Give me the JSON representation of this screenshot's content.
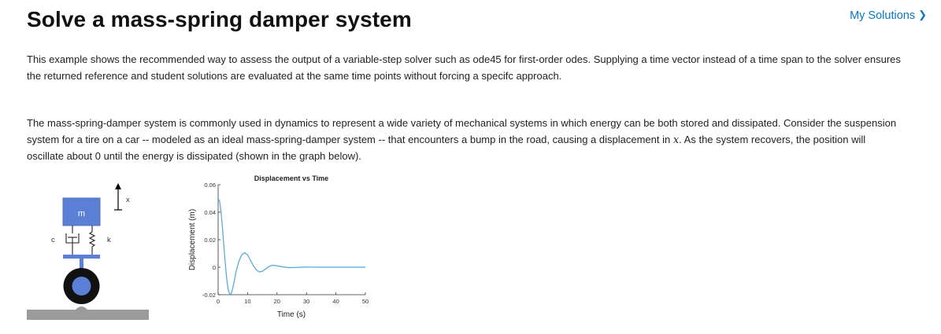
{
  "header": {
    "title": "Solve a mass-spring damper system",
    "my_solutions": "My Solutions"
  },
  "paragraphs": {
    "p1": "This example shows the recommended way to assess the output of a variable-step solver such as ode45 for first-order odes. Supplying a time vector instead of a time span to the solver ensures the returned reference and student solutions are evaluated at the same time points without forcing a specifc approach.",
    "p2_before": "The mass-spring-damper system is commonly used in dynamics to represent a wide variety of mechanical systems in which energy can be both stored and dissipated. Consider the suspension system for a tire on a car -- modeled as an ideal mass-spring-damper system -- that encounters a bump in the road, causing a displacement in ",
    "p2_var": "x",
    "p2_after": ". As the system recovers, the position will oscillate about 0 until the energy is dissipated (shown in the graph below)."
  },
  "diagram": {
    "mass_label": "m",
    "damper_label": "c",
    "spring_label": "k",
    "axis_label": "x",
    "colors": {
      "mass": "#5b7fd4",
      "wheel": "#111111",
      "hub": "#5b7fd4",
      "ground": "#9b9b9b"
    }
  },
  "chart_data": {
    "type": "line",
    "title": "Displacement vs Time",
    "xlabel": "Time (s)",
    "ylabel": "Displacement (m)",
    "xlim": [
      0,
      50
    ],
    "ylim": [
      -0.02,
      0.06
    ],
    "xticks": [
      "0",
      "10",
      "20",
      "30",
      "40",
      "50"
    ],
    "yticks": [
      "-0.02",
      "0",
      "0.02",
      "0.04",
      "0.06"
    ],
    "grid": false,
    "series": [
      {
        "color": "#4ea6dc",
        "x": [
          0,
          0.5,
          1,
          1.5,
          2,
          2.5,
          3,
          3.5,
          4,
          4.5,
          5,
          5.5,
          6,
          7,
          8,
          9,
          10,
          11,
          12,
          13,
          14,
          15,
          16,
          17,
          18,
          19,
          20,
          22,
          24,
          26,
          28,
          30,
          35,
          40,
          45,
          50
        ],
        "y": [
          0.05,
          0.048,
          0.04,
          0.028,
          0.014,
          0.001,
          -0.01,
          -0.017,
          -0.02,
          -0.019,
          -0.015,
          -0.01,
          -0.004,
          0.004,
          0.009,
          0.0105,
          0.009,
          0.005,
          0.001,
          -0.002,
          -0.0035,
          -0.003,
          -0.0015,
          0.0002,
          0.0012,
          0.0014,
          0.001,
          0.0002,
          -0.0003,
          -0.0002,
          0,
          0.0001,
          0,
          0,
          0,
          0
        ]
      }
    ]
  }
}
